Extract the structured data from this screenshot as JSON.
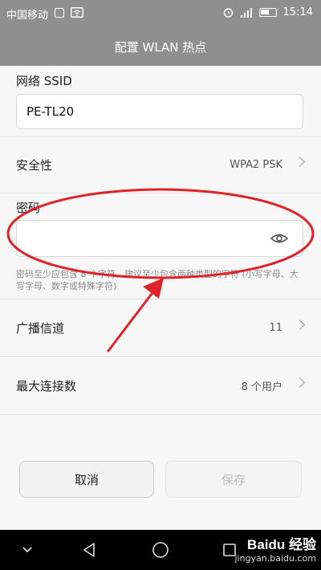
{
  "status_bar": {
    "carrier": "中国移动",
    "time": "15:14"
  },
  "header": {
    "title": "配置 WLAN 热点"
  },
  "ssid": {
    "label": "网络 SSID",
    "value": "PE-TL20"
  },
  "security": {
    "label": "安全性",
    "value": "WPA2 PSK"
  },
  "password": {
    "label": "密码",
    "value": "",
    "hint": "密码至少应包含 8 个字符，建议至少包含两种类型的字符 (小写字母、大写字母、数字或特殊字符)"
  },
  "channel": {
    "label": "广播信道",
    "value": "11"
  },
  "max_connections": {
    "label": "最大连接数",
    "value": "8 个用户"
  },
  "buttons": {
    "cancel": "取消",
    "save": "保存"
  },
  "watermark": {
    "brand": "Baidu 经验",
    "sub": "jingyan.baidu.com"
  },
  "colors": {
    "annotation": "#e0232a",
    "title_bar": "#8f8f8f",
    "nav_bar": "#000000"
  },
  "icons": {
    "status": [
      "image-icon",
      "wifi-icon",
      "alarm-icon",
      "signal-icon",
      "battery-icon"
    ],
    "password_toggle": "eye-icon",
    "nav": [
      "chevron-down-icon",
      "back-icon",
      "home-icon",
      "recent-apps-icon"
    ]
  }
}
